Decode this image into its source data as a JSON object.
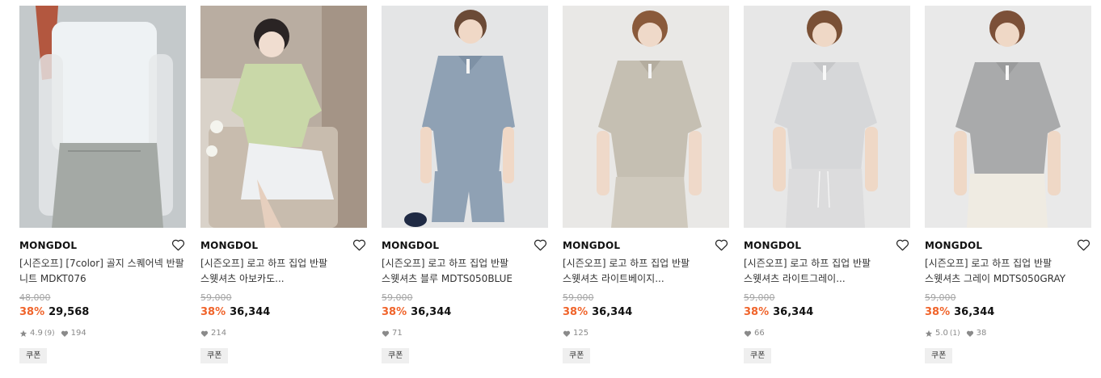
{
  "colors": {
    "discount": "#f0642b",
    "original_price": "#a5a5a5",
    "coupon_bg": "#efefef",
    "meta_text": "#8a8a8a"
  },
  "products": [
    {
      "brand": "MONGDOL",
      "title": "[시즌오프] [7color] 골지 스퀘어넥 반팔\n니트 MDKT076",
      "original_price": "48,000",
      "discount": "38%",
      "price": "29,568",
      "rating": "4.9",
      "review_count": "(9)",
      "likes": "194",
      "coupon": "쿠폰"
    },
    {
      "brand": "MONGDOL",
      "title": "[시즌오프] 로고 하프 집업 반팔\n스웻셔츠 아보카도...",
      "original_price": "59,000",
      "discount": "38%",
      "price": "36,344",
      "likes": "214",
      "coupon": "쿠폰"
    },
    {
      "brand": "MONGDOL",
      "title": "[시즌오프] 로고 하프 집업 반팔\n스웻셔츠 블루 MDTS050BLUE",
      "original_price": "59,000",
      "discount": "38%",
      "price": "36,344",
      "likes": "71",
      "coupon": "쿠폰"
    },
    {
      "brand": "MONGDOL",
      "title": "[시즌오프] 로고 하프 집업 반팔\n스웻셔츠 라이트베이지...",
      "original_price": "59,000",
      "discount": "38%",
      "price": "36,344",
      "likes": "125",
      "coupon": "쿠폰"
    },
    {
      "brand": "MONGDOL",
      "title": "[시즌오프] 로고 하프 집업 반팔\n스웻셔츠 라이트그레이...",
      "original_price": "59,000",
      "discount": "38%",
      "price": "36,344",
      "likes": "66",
      "coupon": "쿠폰"
    },
    {
      "brand": "MONGDOL",
      "title": "[시즌오프] 로고 하프 집업 반팔\n스웻셔츠 그레이 MDTS050GRAY",
      "original_price": "59,000",
      "discount": "38%",
      "price": "36,344",
      "rating": "5.0",
      "review_count": "(1)",
      "likes": "38",
      "coupon": "쿠폰"
    }
  ]
}
